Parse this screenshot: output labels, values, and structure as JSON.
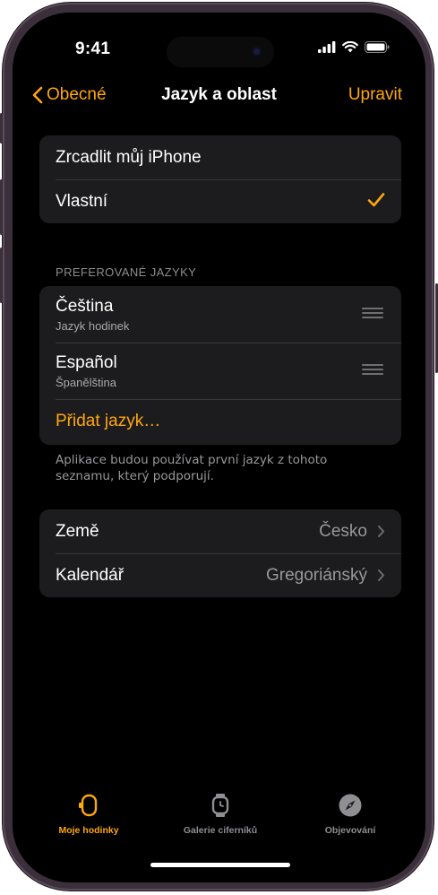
{
  "status": {
    "time": "9:41"
  },
  "nav": {
    "back_label": "Obecné",
    "title": "Jazyk a oblast",
    "edit_label": "Upravit"
  },
  "source_group": {
    "items": [
      {
        "label": "Zrcadlit můj iPhone",
        "selected": false
      },
      {
        "label": "Vlastní",
        "selected": true
      }
    ]
  },
  "languages": {
    "header": "PREFEROVANÉ JAZYKY",
    "items": [
      {
        "name": "Čeština",
        "subtitle": "Jazyk hodinek"
      },
      {
        "name": "Español",
        "subtitle": "Španělština"
      }
    ],
    "add_label": "Přidat jazyk…",
    "footer": "Aplikace budou používat první jazyk z tohoto seznamu, který podporují."
  },
  "region_group": {
    "items": [
      {
        "label": "Země",
        "value": "Česko"
      },
      {
        "label": "Kalendář",
        "value": "Gregoriánský"
      }
    ]
  },
  "tabbar": {
    "items": [
      {
        "label": "Moje hodinky",
        "icon": "watch-side-icon",
        "active": true
      },
      {
        "label": "Galerie ciferníků",
        "icon": "watch-face-icon",
        "active": false
      },
      {
        "label": "Objevování",
        "icon": "compass-icon",
        "active": false
      }
    ]
  },
  "colors": {
    "accent": "#ffa711",
    "background": "#000000",
    "group": "#1c1c1e"
  }
}
